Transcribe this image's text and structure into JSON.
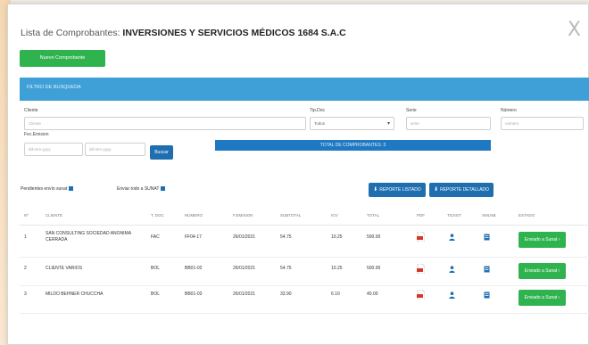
{
  "modal": {
    "title_prefix": "Lista de Comprobantes:",
    "company": "INVERSIONES Y SERVICIOS MÉDICOS 1684 S.A.C",
    "close": "X"
  },
  "buttons": {
    "new_voucher": "Nuevo Comprobante",
    "search": "Buscar",
    "report_list": "REPORTE LISTADO",
    "report_detail": "REPORTE DETALLADO",
    "send_sunat": "Enviado a Sunat ›"
  },
  "filters": {
    "header": "FILTRO DE BUSQUEDA",
    "client_label": "Cliente",
    "client_placeholder": "Cliente",
    "date_label": "Fec.Emision",
    "date_from_placeholder": "dd-mm-yyyy",
    "date_to_placeholder": "dd-mm-yyyy",
    "doc_type_label": "Tip.Doc",
    "doc_type_value": "Todos",
    "serie_label": "Serie",
    "serie_placeholder": "serie",
    "numero_label": "Número",
    "numero_placeholder": "número"
  },
  "total_bar": "TOTAL DE COMPROBANTES: 3",
  "checks": {
    "pending": "Pendientes envío sunat",
    "sent": "Enviar todo a SUNAT"
  },
  "table": {
    "headers": [
      "Nº",
      "CLIENTE",
      "T. DOC",
      "NÚMERO",
      "F.EMISION",
      "SUBTOTAL",
      "IGV",
      "TOTAL",
      "PDF",
      "TICKET",
      "XMLNB",
      "ESTADO"
    ],
    "rows": [
      {
        "n": "1",
        "client": "SAN CONSULTING SOCIEDAD ANONIMA CERRADA",
        "tdoc": "FAC",
        "number": "FF04-17",
        "date": "26/01/2021",
        "subtotal": "54.75",
        "igv": "10.25",
        "total": "500.00"
      },
      {
        "n": "2",
        "client": "CLIENTE VARIOS",
        "tdoc": "BOL",
        "number": "BB01-02",
        "date": "26/01/2021",
        "subtotal": "54.75",
        "igv": "10.25",
        "total": "500.00"
      },
      {
        "n": "3",
        "client": "MILDO BEHNER CHUCCHA",
        "tdoc": "BOL",
        "number": "BB01-03",
        "date": "26/01/2021",
        "subtotal": "33.90",
        "igv": "6.10",
        "total": "40.00"
      }
    ]
  },
  "icons": {
    "pdf": "pdf-icon",
    "ticket": "person-icon",
    "xml": "document-icon"
  },
  "colors": {
    "accent_green": "#2fb34f",
    "header_blue": "#3f9fd7",
    "button_blue": "#1f6fb0",
    "pdf_red": "#d9342b"
  }
}
